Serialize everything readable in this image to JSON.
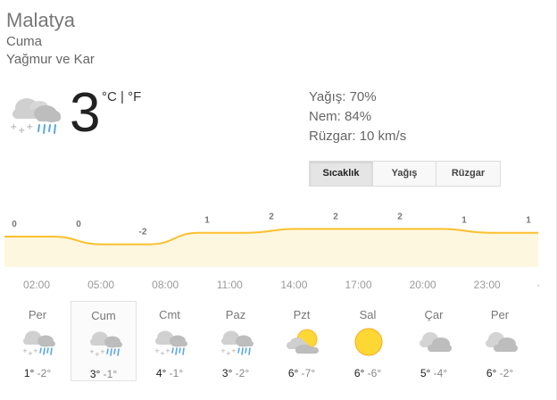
{
  "location": "Malatya",
  "day": "Cuma",
  "condition": "Yağmur ve Kar",
  "current": {
    "temp": "3",
    "unit_c": "°C",
    "unit_sep": " | ",
    "unit_f": "°F",
    "precip": "Yağış: 70%",
    "humidity": "Nem: 84%",
    "wind": "Rüzgar: 10 km/s"
  },
  "tabs": [
    "Sıcaklık",
    "Yağış",
    "Rüzgar"
  ],
  "chart_data": {
    "type": "area",
    "x": [
      "02:00",
      "05:00",
      "08:00",
      "11:00",
      "14:00",
      "17:00",
      "20:00",
      "23:00"
    ],
    "x_value_labels": [
      "0",
      "0",
      "-2",
      "1",
      "2",
      "2",
      "2",
      "1",
      "1"
    ],
    "values": [
      0,
      0,
      -2,
      -2,
      1,
      1,
      2,
      2,
      2,
      2,
      1,
      1
    ],
    "color": "#fbc02d",
    "fill": "#fef7e0"
  },
  "forecast": [
    {
      "day": "Per",
      "hi": "1°",
      "lo": "-2°",
      "icon": "rain-snow-icon"
    },
    {
      "day": "Cum",
      "hi": "3°",
      "lo": "-1°",
      "icon": "rain-snow-icon"
    },
    {
      "day": "Cmt",
      "hi": "4°",
      "lo": "-1°",
      "icon": "rain-snow-icon"
    },
    {
      "day": "Paz",
      "hi": "3°",
      "lo": "-2°",
      "icon": "rain-snow-icon"
    },
    {
      "day": "Pzt",
      "hi": "6°",
      "lo": "-7°",
      "icon": "partly-cloudy-icon"
    },
    {
      "day": "Sal",
      "hi": "6°",
      "lo": "-6°",
      "icon": "sunny-icon"
    },
    {
      "day": "Çar",
      "hi": "5°",
      "lo": "-4°",
      "icon": "cloudy-icon"
    },
    {
      "day": "Per",
      "hi": "6°",
      "lo": "-2°",
      "icon": "cloudy-icon"
    }
  ]
}
